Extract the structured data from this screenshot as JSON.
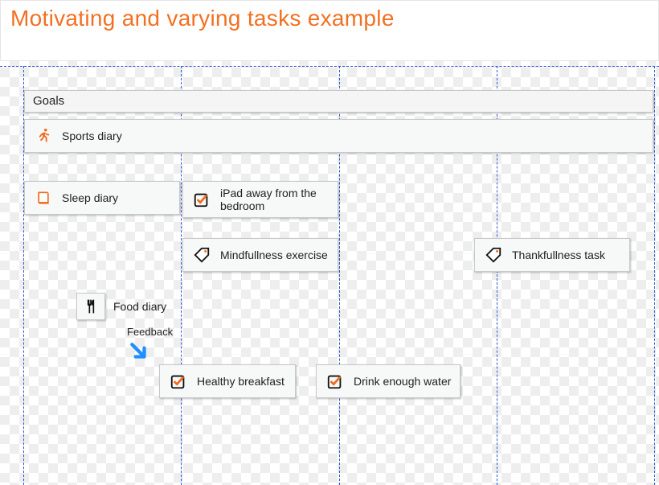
{
  "title": "Motivating and varying tasks example",
  "goals_label": "Goals",
  "cards": {
    "sports_diary": "Sports diary",
    "sleep_diary": "Sleep diary",
    "ipad_away": "iPad away from the bedroom",
    "mindfulness": "Mindfullness exercise",
    "thankfulness": "Thankfullness task",
    "food_diary": "Food diary",
    "feedback": "Feedback",
    "healthy_breakfast": "Healthy breakfast",
    "drink_water": "Drink enough water"
  },
  "colors": {
    "accent": "#f37021",
    "guide": "#2b58d6",
    "arrow": "#1e90ff"
  }
}
